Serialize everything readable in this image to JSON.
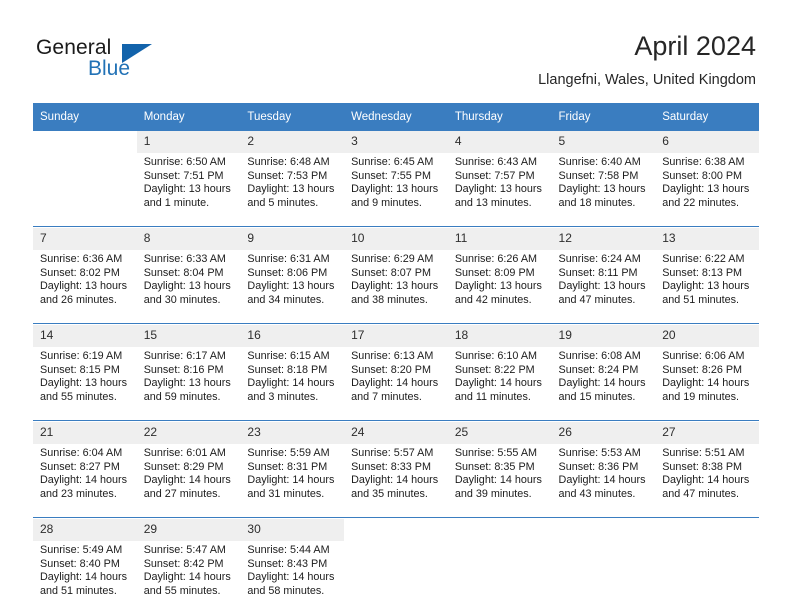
{
  "branding": {
    "logo_text_primary": "General",
    "logo_text_secondary": "Blue",
    "logo_triangle_color": "#1263ab",
    "logo_secondary_color": "#2272b6"
  },
  "header": {
    "title": "April 2024",
    "subtitle": "Llangefni, Wales, United Kingdom"
  },
  "theme": {
    "header_row_bg": "#3a7dc0",
    "daynum_bg": "#efefef",
    "separator_color": "#3a7dc0",
    "text_color": "#1c1c1c"
  },
  "weekday_headers": [
    "Sunday",
    "Monday",
    "Tuesday",
    "Wednesday",
    "Thursday",
    "Friday",
    "Saturday"
  ],
  "weeks": [
    [
      {
        "day": "",
        "sunrise": "",
        "sunset": "",
        "daylight1": "",
        "daylight2": "",
        "empty": true
      },
      {
        "day": "1",
        "sunrise": "Sunrise: 6:50 AM",
        "sunset": "Sunset: 7:51 PM",
        "daylight1": "Daylight: 13 hours",
        "daylight2": "and 1 minute.",
        "empty": false
      },
      {
        "day": "2",
        "sunrise": "Sunrise: 6:48 AM",
        "sunset": "Sunset: 7:53 PM",
        "daylight1": "Daylight: 13 hours",
        "daylight2": "and 5 minutes.",
        "empty": false
      },
      {
        "day": "3",
        "sunrise": "Sunrise: 6:45 AM",
        "sunset": "Sunset: 7:55 PM",
        "daylight1": "Daylight: 13 hours",
        "daylight2": "and 9 minutes.",
        "empty": false
      },
      {
        "day": "4",
        "sunrise": "Sunrise: 6:43 AM",
        "sunset": "Sunset: 7:57 PM",
        "daylight1": "Daylight: 13 hours",
        "daylight2": "and 13 minutes.",
        "empty": false
      },
      {
        "day": "5",
        "sunrise": "Sunrise: 6:40 AM",
        "sunset": "Sunset: 7:58 PM",
        "daylight1": "Daylight: 13 hours",
        "daylight2": "and 18 minutes.",
        "empty": false
      },
      {
        "day": "6",
        "sunrise": "Sunrise: 6:38 AM",
        "sunset": "Sunset: 8:00 PM",
        "daylight1": "Daylight: 13 hours",
        "daylight2": "and 22 minutes.",
        "empty": false
      }
    ],
    [
      {
        "day": "7",
        "sunrise": "Sunrise: 6:36 AM",
        "sunset": "Sunset: 8:02 PM",
        "daylight1": "Daylight: 13 hours",
        "daylight2": "and 26 minutes.",
        "empty": false
      },
      {
        "day": "8",
        "sunrise": "Sunrise: 6:33 AM",
        "sunset": "Sunset: 8:04 PM",
        "daylight1": "Daylight: 13 hours",
        "daylight2": "and 30 minutes.",
        "empty": false
      },
      {
        "day": "9",
        "sunrise": "Sunrise: 6:31 AM",
        "sunset": "Sunset: 8:06 PM",
        "daylight1": "Daylight: 13 hours",
        "daylight2": "and 34 minutes.",
        "empty": false
      },
      {
        "day": "10",
        "sunrise": "Sunrise: 6:29 AM",
        "sunset": "Sunset: 8:07 PM",
        "daylight1": "Daylight: 13 hours",
        "daylight2": "and 38 minutes.",
        "empty": false
      },
      {
        "day": "11",
        "sunrise": "Sunrise: 6:26 AM",
        "sunset": "Sunset: 8:09 PM",
        "daylight1": "Daylight: 13 hours",
        "daylight2": "and 42 minutes.",
        "empty": false
      },
      {
        "day": "12",
        "sunrise": "Sunrise: 6:24 AM",
        "sunset": "Sunset: 8:11 PM",
        "daylight1": "Daylight: 13 hours",
        "daylight2": "and 47 minutes.",
        "empty": false
      },
      {
        "day": "13",
        "sunrise": "Sunrise: 6:22 AM",
        "sunset": "Sunset: 8:13 PM",
        "daylight1": "Daylight: 13 hours",
        "daylight2": "and 51 minutes.",
        "empty": false
      }
    ],
    [
      {
        "day": "14",
        "sunrise": "Sunrise: 6:19 AM",
        "sunset": "Sunset: 8:15 PM",
        "daylight1": "Daylight: 13 hours",
        "daylight2": "and 55 minutes.",
        "empty": false
      },
      {
        "day": "15",
        "sunrise": "Sunrise: 6:17 AM",
        "sunset": "Sunset: 8:16 PM",
        "daylight1": "Daylight: 13 hours",
        "daylight2": "and 59 minutes.",
        "empty": false
      },
      {
        "day": "16",
        "sunrise": "Sunrise: 6:15 AM",
        "sunset": "Sunset: 8:18 PM",
        "daylight1": "Daylight: 14 hours",
        "daylight2": "and 3 minutes.",
        "empty": false
      },
      {
        "day": "17",
        "sunrise": "Sunrise: 6:13 AM",
        "sunset": "Sunset: 8:20 PM",
        "daylight1": "Daylight: 14 hours",
        "daylight2": "and 7 minutes.",
        "empty": false
      },
      {
        "day": "18",
        "sunrise": "Sunrise: 6:10 AM",
        "sunset": "Sunset: 8:22 PM",
        "daylight1": "Daylight: 14 hours",
        "daylight2": "and 11 minutes.",
        "empty": false
      },
      {
        "day": "19",
        "sunrise": "Sunrise: 6:08 AM",
        "sunset": "Sunset: 8:24 PM",
        "daylight1": "Daylight: 14 hours",
        "daylight2": "and 15 minutes.",
        "empty": false
      },
      {
        "day": "20",
        "sunrise": "Sunrise: 6:06 AM",
        "sunset": "Sunset: 8:26 PM",
        "daylight1": "Daylight: 14 hours",
        "daylight2": "and 19 minutes.",
        "empty": false
      }
    ],
    [
      {
        "day": "21",
        "sunrise": "Sunrise: 6:04 AM",
        "sunset": "Sunset: 8:27 PM",
        "daylight1": "Daylight: 14 hours",
        "daylight2": "and 23 minutes.",
        "empty": false
      },
      {
        "day": "22",
        "sunrise": "Sunrise: 6:01 AM",
        "sunset": "Sunset: 8:29 PM",
        "daylight1": "Daylight: 14 hours",
        "daylight2": "and 27 minutes.",
        "empty": false
      },
      {
        "day": "23",
        "sunrise": "Sunrise: 5:59 AM",
        "sunset": "Sunset: 8:31 PM",
        "daylight1": "Daylight: 14 hours",
        "daylight2": "and 31 minutes.",
        "empty": false
      },
      {
        "day": "24",
        "sunrise": "Sunrise: 5:57 AM",
        "sunset": "Sunset: 8:33 PM",
        "daylight1": "Daylight: 14 hours",
        "daylight2": "and 35 minutes.",
        "empty": false
      },
      {
        "day": "25",
        "sunrise": "Sunrise: 5:55 AM",
        "sunset": "Sunset: 8:35 PM",
        "daylight1": "Daylight: 14 hours",
        "daylight2": "and 39 minutes.",
        "empty": false
      },
      {
        "day": "26",
        "sunrise": "Sunrise: 5:53 AM",
        "sunset": "Sunset: 8:36 PM",
        "daylight1": "Daylight: 14 hours",
        "daylight2": "and 43 minutes.",
        "empty": false
      },
      {
        "day": "27",
        "sunrise": "Sunrise: 5:51 AM",
        "sunset": "Sunset: 8:38 PM",
        "daylight1": "Daylight: 14 hours",
        "daylight2": "and 47 minutes.",
        "empty": false
      }
    ],
    [
      {
        "day": "28",
        "sunrise": "Sunrise: 5:49 AM",
        "sunset": "Sunset: 8:40 PM",
        "daylight1": "Daylight: 14 hours",
        "daylight2": "and 51 minutes.",
        "empty": false
      },
      {
        "day": "29",
        "sunrise": "Sunrise: 5:47 AM",
        "sunset": "Sunset: 8:42 PM",
        "daylight1": "Daylight: 14 hours",
        "daylight2": "and 55 minutes.",
        "empty": false
      },
      {
        "day": "30",
        "sunrise": "Sunrise: 5:44 AM",
        "sunset": "Sunset: 8:43 PM",
        "daylight1": "Daylight: 14 hours",
        "daylight2": "and 58 minutes.",
        "empty": false
      },
      {
        "day": "",
        "sunrise": "",
        "sunset": "",
        "daylight1": "",
        "daylight2": "",
        "empty": true
      },
      {
        "day": "",
        "sunrise": "",
        "sunset": "",
        "daylight1": "",
        "daylight2": "",
        "empty": true
      },
      {
        "day": "",
        "sunrise": "",
        "sunset": "",
        "daylight1": "",
        "daylight2": "",
        "empty": true
      },
      {
        "day": "",
        "sunrise": "",
        "sunset": "",
        "daylight1": "",
        "daylight2": "",
        "empty": true
      }
    ]
  ]
}
